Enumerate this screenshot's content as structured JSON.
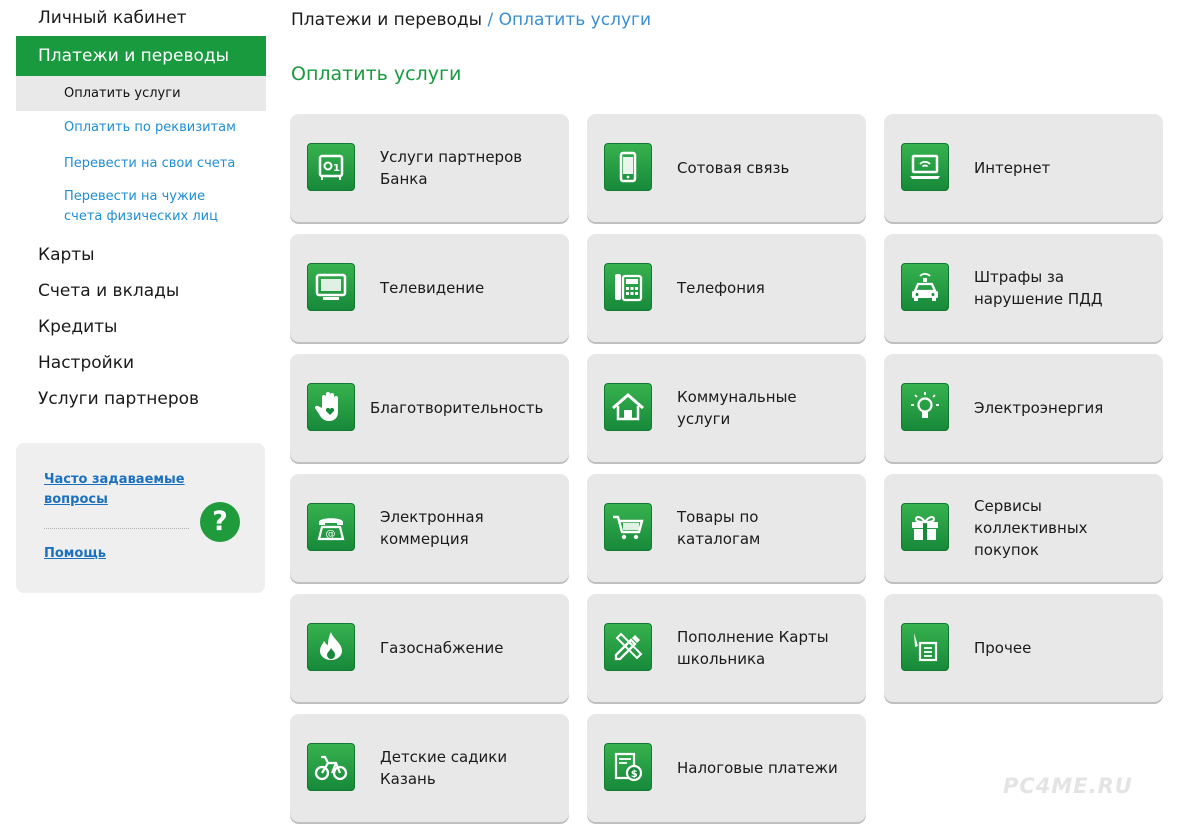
{
  "sidebar": {
    "personal_cabinet": "Личный кабинет",
    "payments": "Платежи и переводы",
    "sub": {
      "pay_services": "Оплатить услуги",
      "pay_by_details": "Оплатить по реквизитам",
      "transfer_own": "Перевести на свои счета",
      "transfer_others_line1": "Перевести на чужие",
      "transfer_others_line2": "счета физических лиц"
    },
    "cards": "Карты",
    "accounts": "Счета и вклады",
    "credits": "Кредиты",
    "settings": "Настройки",
    "partner_services": "Услуги партнеров"
  },
  "help": {
    "faq_line1": "Часто задаваемые",
    "faq_line2": "вопросы",
    "help": "Помощь",
    "icon_glyph": "?"
  },
  "breadcrumb": {
    "root": "Платежи и переводы",
    "separator": "/",
    "current": "Оплатить услуги"
  },
  "page_title": "Оплатить услуги",
  "tiles": [
    {
      "line1": "Услуги партнеров",
      "line2": "Банка",
      "icon": "safe-icon"
    },
    {
      "line1": "Сотовая связь",
      "icon": "mobile-phone-icon"
    },
    {
      "line1": "Интернет",
      "icon": "laptop-wifi-icon"
    },
    {
      "line1": "Телевидение",
      "icon": "tv-icon"
    },
    {
      "line1": "Телефония",
      "icon": "desk-phone-icon"
    },
    {
      "line1": "Штрафы за",
      "line2": "нарушение ПДД",
      "icon": "police-car-icon"
    },
    {
      "line1": "Благотворительность",
      "icon": "hand-heart-icon"
    },
    {
      "line1": "Коммунальные",
      "line2": "услуги",
      "icon": "house-icon"
    },
    {
      "line1": "Электроэнергия",
      "icon": "lightbulb-icon"
    },
    {
      "line1": "Электронная",
      "line2": "коммерция",
      "icon": "email-phone-icon"
    },
    {
      "line1": "Товары по",
      "line2": "каталогам",
      "icon": "shopping-cart-icon"
    },
    {
      "line1": "Сервисы",
      "line2": "коллективных",
      "line3": "покупок",
      "icon": "gift-icon"
    },
    {
      "line1": "Газоснабжение",
      "icon": "flame-icon"
    },
    {
      "line1": "Пополнение Карты",
      "line2": "школьника",
      "icon": "pencil-ruler-icon"
    },
    {
      "line1": "Прочее",
      "icon": "pen-document-icon"
    },
    {
      "line1": "Детские садики",
      "line2": "Казань",
      "icon": "bicycle-icon"
    },
    {
      "line1": "Налоговые платежи",
      "icon": "tax-document-icon"
    }
  ],
  "watermark": "PC4ME.RU",
  "colors": {
    "accent_green": "#1a9a3f",
    "link_blue": "#1e8ed6",
    "tile_bg": "#e8e8e8"
  }
}
